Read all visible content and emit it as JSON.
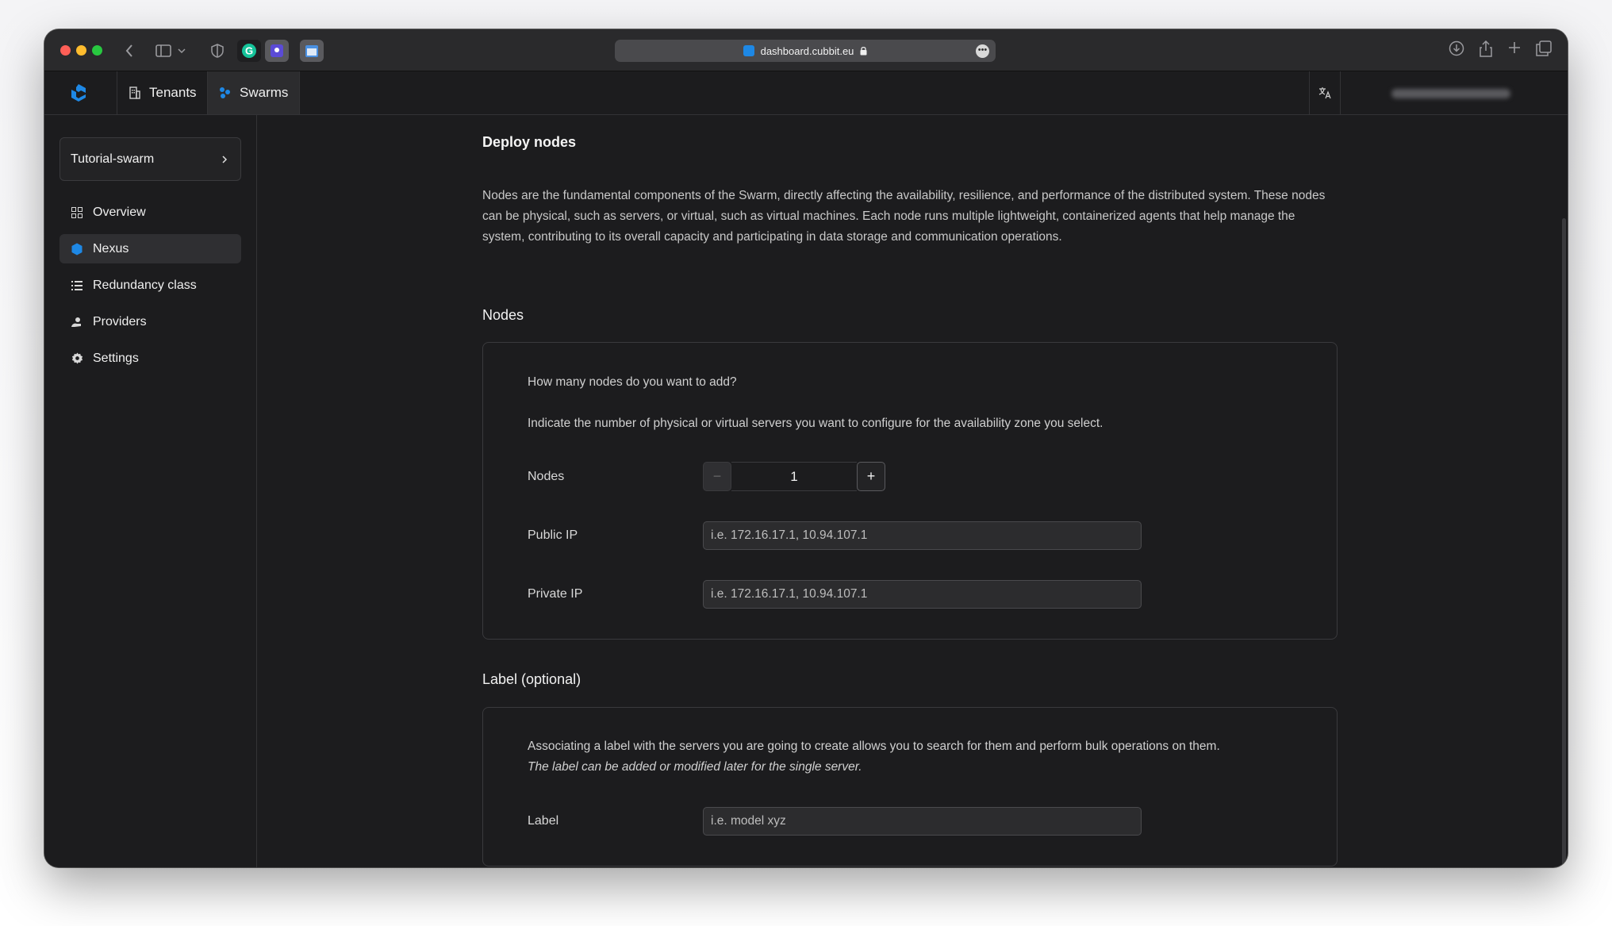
{
  "browser": {
    "url": "dashboard.cubbit.eu"
  },
  "nav": {
    "tabs": [
      {
        "label": "Tenants",
        "icon": "building-icon"
      },
      {
        "label": "Swarms",
        "icon": "swarm-icon"
      }
    ],
    "translate_icon": "translate-icon"
  },
  "sidebar": {
    "swarm_name": "Tutorial-swarm",
    "items": [
      {
        "label": "Overview",
        "icon": "grid-icon"
      },
      {
        "label": "Nexus",
        "icon": "hexagon-icon"
      },
      {
        "label": "Redundancy class",
        "icon": "list-icon"
      },
      {
        "label": "Providers",
        "icon": "providers-icon"
      },
      {
        "label": "Settings",
        "icon": "gear-icon"
      }
    ]
  },
  "main": {
    "title": "Deploy nodes",
    "intro": "Nodes are the fundamental components of the Swarm, directly affecting the availability, resilience, and performance of the distributed system. These nodes can be physical, such as servers, or virtual, such as virtual machines. Each node runs multiple lightweight, containerized agents that help manage the system, contributing to its overall capacity and participating in data storage and communication operations.",
    "nodes_section": {
      "title": "Nodes",
      "question": "How many nodes do you want to add?",
      "hint": "Indicate the number of physical or virtual servers you want to configure for the availability zone you select.",
      "nodes_label": "Nodes",
      "nodes_value": "1",
      "minus": "−",
      "plus": "+",
      "public_ip_label": "Public IP",
      "public_ip_placeholder": "i.e. 172.16.17.1, 10.94.107.1",
      "private_ip_label": "Private IP",
      "private_ip_placeholder": "i.e. 172.16.17.1, 10.94.107.1"
    },
    "label_section": {
      "title": "Label (optional)",
      "text": "Associating a label with the servers you are going to create allows you to search for them and perform bulk operations on them.",
      "note": "The label can be added or modified later for the single server.",
      "label_label": "Label",
      "label_placeholder": "i.e. model xyz"
    }
  },
  "colors": {
    "background": "#1c1c1e",
    "accent": "#1e88e5"
  }
}
